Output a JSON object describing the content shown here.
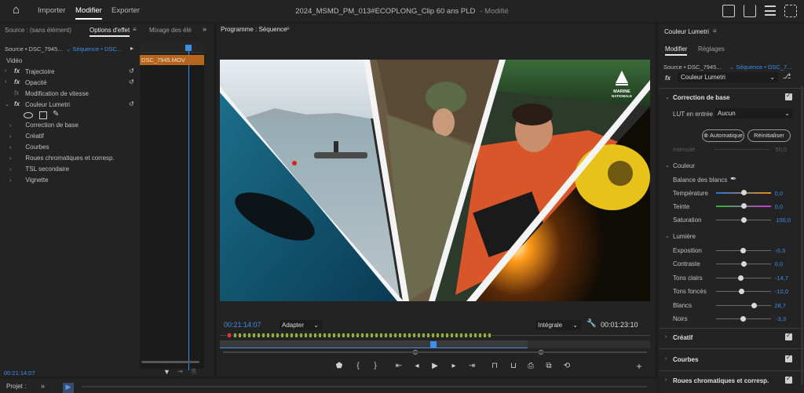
{
  "topbar": {
    "home_label": "⌂",
    "nav": [
      "Importer",
      "Modifier",
      "Exporter"
    ],
    "title": "2024_MSMD_PM_013#ECOPLONG_Clip 60 ans PLD",
    "modified": "- Modifié"
  },
  "effects_panel": {
    "source_tab": "Source : (sans élément)",
    "options_tab": "Options d'effet",
    "mixer_tab": "Mixage des élé",
    "source_label": "Source • DSC_7945...",
    "sequence_label": "Séquence • DSC...",
    "video_header": "Vidéo",
    "effects": [
      "Trajectoire",
      "Opacité",
      "Modification de vitesse",
      "Couleur Lumetri"
    ],
    "lumetri_items": [
      "Correction de base",
      "Créatif",
      "Courbes",
      "Roues chromatiques et corresp.",
      "TSL secondaire",
      "Vignette"
    ],
    "clip_name": "DSC_7945.MOV",
    "timecode": "00:21:14:07"
  },
  "program_monitor": {
    "title": "Programme : Séquence",
    "timecode": "00:21:14:07",
    "fit": "Adapter",
    "quality": "Intégrale",
    "duration": "00:01:23:10",
    "logo_line1": "MARINE",
    "logo_line2": "NATIONALE"
  },
  "lumetri": {
    "title": "Couleur Lumetri",
    "tabs": [
      "Modifier",
      "Réglages"
    ],
    "source_label": "Source • DSC_7945...",
    "sequence_label": "Séquence • DSC_7...",
    "fx_label": "Couleur Lumetri",
    "basic_title": "Correction de base",
    "lut_label": "LUT en entrée",
    "lut_value": "Aucun",
    "auto_button": "Automatique",
    "reset_button": "Réinitialiser",
    "intensity_label": "Intensité",
    "intensity_value": "50,0",
    "color_header": "Couleur",
    "wb_label": "Balance des blancs",
    "color_rows": [
      {
        "label": "Température",
        "value": "0,0"
      },
      {
        "label": "Teinte",
        "value": "0,0"
      },
      {
        "label": "Saturation",
        "value": "100,0"
      }
    ],
    "light_header": "Lumière",
    "light_rows": [
      {
        "label": "Exposition",
        "value": "-0,3"
      },
      {
        "label": "Contraste",
        "value": "0,0"
      },
      {
        "label": "Tons clairs",
        "value": "-14,7"
      },
      {
        "label": "Tons foncés",
        "value": "-10,0"
      },
      {
        "label": "Blancs",
        "value": "28,7"
      },
      {
        "label": "Noirs",
        "value": "-3,3"
      }
    ],
    "collapsed_sections": [
      "Créatif",
      "Courbes",
      "Roues chromatiques et corresp."
    ]
  },
  "bottom": {
    "project_tab": "Projet :"
  }
}
